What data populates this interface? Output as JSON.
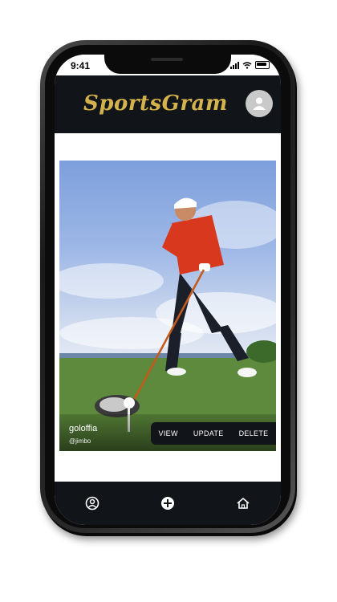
{
  "status_bar": {
    "time": "9:41"
  },
  "header": {
    "app_name": "SportsGram"
  },
  "post": {
    "title": "goloffia",
    "username": "@jimbo",
    "actions": {
      "view": "VIEW",
      "update": "UPDATE",
      "delete": "DELETE"
    }
  },
  "bottom_nav": [
    {
      "icon": "profile-icon"
    },
    {
      "icon": "add-icon"
    },
    {
      "icon": "home-icon"
    }
  ],
  "colors": {
    "header_bg": "#111418",
    "logo_gold": "#d4b24c",
    "nav_bg": "#111418"
  }
}
